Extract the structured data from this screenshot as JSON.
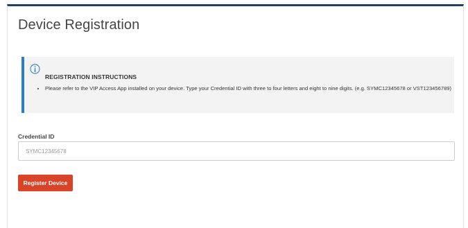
{
  "page": {
    "title": "Device Registration"
  },
  "instructions": {
    "icon": "info-icon",
    "title": "REGISTRATION INSTRUCTIONS",
    "items": [
      "Please refer to the VIP Access App installed on your device. Type your Credential ID with three to four letters and eight to nine digits. (e.g. SYMC12345678 or VST123456789)"
    ]
  },
  "credential": {
    "label": "Credential ID",
    "value": "",
    "placeholder": "SYMC12345678"
  },
  "actions": {
    "register_label": "Register Device"
  },
  "colors": {
    "top_border": "#1f3f66",
    "info_accent": "#2f7dc0",
    "instructions_bg": "#f3f3f3",
    "button": "#d9432a"
  }
}
